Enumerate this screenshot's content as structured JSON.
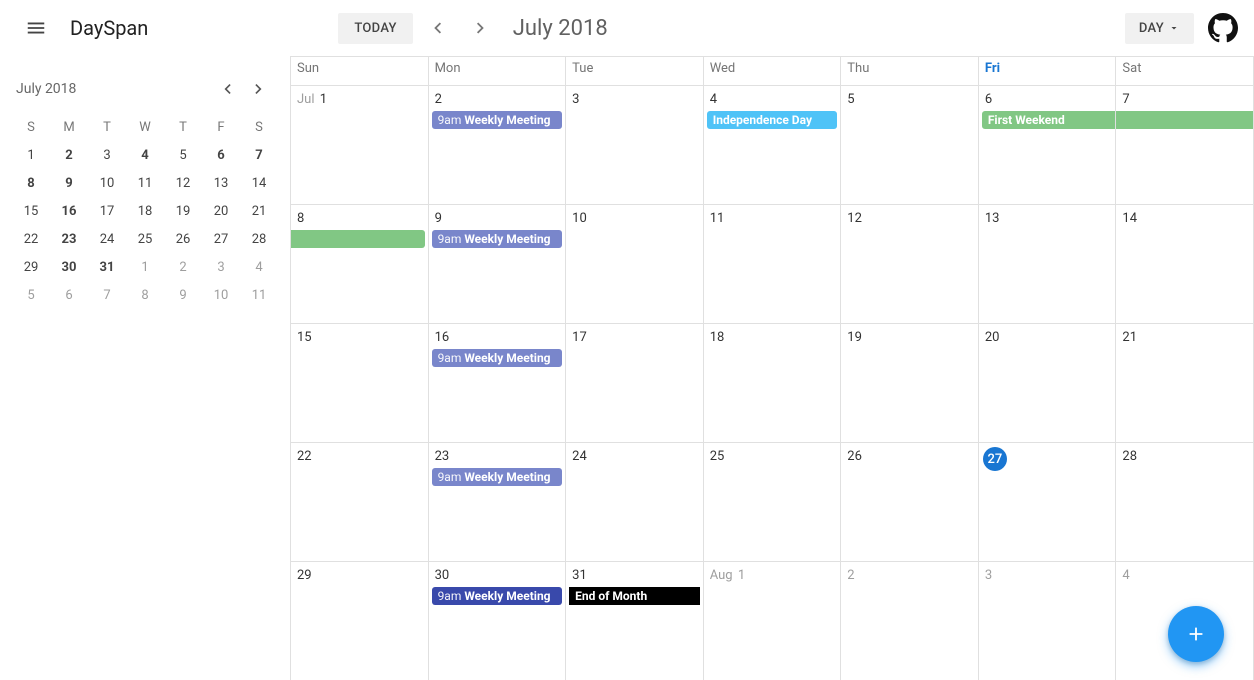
{
  "toolbar": {
    "app_title": "DaySpan",
    "today_label": "TODAY",
    "period_title": "July 2018",
    "view_label": "DAY"
  },
  "mini": {
    "title": "July 2018",
    "dow": [
      "S",
      "M",
      "T",
      "W",
      "T",
      "F",
      "S"
    ],
    "rows": [
      [
        {
          "n": "1"
        },
        {
          "n": "2",
          "bold": true
        },
        {
          "n": "3"
        },
        {
          "n": "4",
          "bold": true
        },
        {
          "n": "5"
        },
        {
          "n": "6",
          "bold": true
        },
        {
          "n": "7",
          "bold": true
        }
      ],
      [
        {
          "n": "8",
          "bold": true
        },
        {
          "n": "9",
          "bold": true
        },
        {
          "n": "10"
        },
        {
          "n": "11"
        },
        {
          "n": "12"
        },
        {
          "n": "13"
        },
        {
          "n": "14"
        }
      ],
      [
        {
          "n": "15"
        },
        {
          "n": "16",
          "bold": true
        },
        {
          "n": "17"
        },
        {
          "n": "18"
        },
        {
          "n": "19"
        },
        {
          "n": "20"
        },
        {
          "n": "21"
        }
      ],
      [
        {
          "n": "22"
        },
        {
          "n": "23",
          "bold": true
        },
        {
          "n": "24"
        },
        {
          "n": "25"
        },
        {
          "n": "26"
        },
        {
          "n": "27"
        },
        {
          "n": "28"
        }
      ],
      [
        {
          "n": "29"
        },
        {
          "n": "30",
          "bold": true
        },
        {
          "n": "31",
          "bold": true
        },
        {
          "n": "1",
          "out": true
        },
        {
          "n": "2",
          "out": true
        },
        {
          "n": "3",
          "out": true
        },
        {
          "n": "4",
          "out": true
        }
      ],
      [
        {
          "n": "5",
          "out": true
        },
        {
          "n": "6",
          "out": true
        },
        {
          "n": "7",
          "out": true
        },
        {
          "n": "8",
          "out": true
        },
        {
          "n": "9",
          "out": true
        },
        {
          "n": "10",
          "out": true
        },
        {
          "n": "11",
          "out": true
        }
      ]
    ]
  },
  "calendar": {
    "dow": [
      "Sun",
      "Mon",
      "Tue",
      "Wed",
      "Thu",
      "Fri",
      "Sat"
    ],
    "fri_index": 5,
    "weeks": [
      [
        {
          "label": "1",
          "prefix": "Jul",
          "events": []
        },
        {
          "label": "2",
          "events": [
            {
              "type": "weekly",
              "time": "9am",
              "title": "Weekly Meeting"
            }
          ]
        },
        {
          "label": "3",
          "events": []
        },
        {
          "label": "4",
          "events": [
            {
              "type": "holiday",
              "title": "Independence Day"
            }
          ]
        },
        {
          "label": "5",
          "events": []
        },
        {
          "label": "6",
          "events": [
            {
              "type": "weekend",
              "title": "First Weekend"
            }
          ]
        },
        {
          "label": "7",
          "events": [
            {
              "type": "weekend-cont"
            }
          ]
        }
      ],
      [
        {
          "label": "8",
          "events": [
            {
              "type": "weekend-tail"
            }
          ]
        },
        {
          "label": "9",
          "events": [
            {
              "type": "weekly",
              "time": "9am",
              "title": "Weekly Meeting"
            }
          ]
        },
        {
          "label": "10",
          "events": []
        },
        {
          "label": "11",
          "events": []
        },
        {
          "label": "12",
          "events": []
        },
        {
          "label": "13",
          "events": []
        },
        {
          "label": "14",
          "events": []
        }
      ],
      [
        {
          "label": "15",
          "events": []
        },
        {
          "label": "16",
          "events": [
            {
              "type": "weekly",
              "time": "9am",
              "title": "Weekly Meeting"
            }
          ]
        },
        {
          "label": "17",
          "events": []
        },
        {
          "label": "18",
          "events": []
        },
        {
          "label": "19",
          "events": []
        },
        {
          "label": "20",
          "events": []
        },
        {
          "label": "21",
          "events": []
        }
      ],
      [
        {
          "label": "22",
          "events": []
        },
        {
          "label": "23",
          "events": [
            {
              "type": "weekly",
              "time": "9am",
              "title": "Weekly Meeting"
            }
          ]
        },
        {
          "label": "24",
          "events": []
        },
        {
          "label": "25",
          "events": []
        },
        {
          "label": "26",
          "events": []
        },
        {
          "label": "27",
          "today": true,
          "events": []
        },
        {
          "label": "28",
          "events": []
        }
      ],
      [
        {
          "label": "29",
          "events": []
        },
        {
          "label": "30",
          "events": [
            {
              "type": "selected",
              "time": "9am",
              "title": "Weekly Meeting"
            }
          ]
        },
        {
          "label": "31",
          "events": [
            {
              "type": "black",
              "title": "End of Month"
            }
          ]
        },
        {
          "label": "1",
          "prefix": "Aug",
          "out": true,
          "events": []
        },
        {
          "label": "2",
          "out": true,
          "events": []
        },
        {
          "label": "3",
          "out": true,
          "events": []
        },
        {
          "label": "4",
          "out": true,
          "events": []
        }
      ]
    ]
  }
}
